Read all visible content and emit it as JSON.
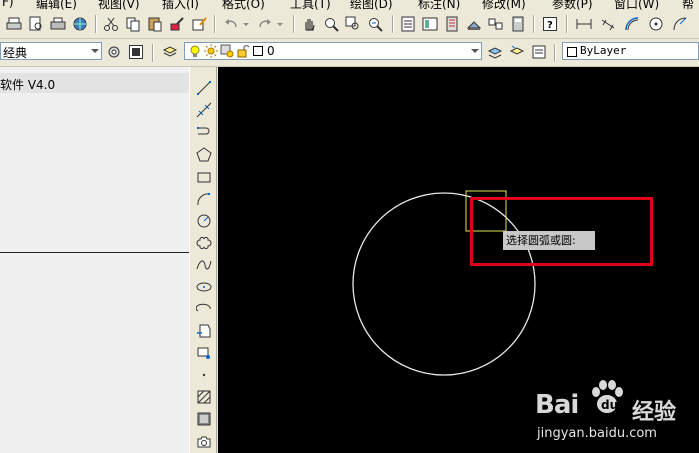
{
  "menubar": {
    "items": [
      "F)",
      "编辑(E)",
      "视图(V)",
      "插入(I)",
      "格式(O)",
      "工具(T)",
      "绘图(D)",
      "标注(N)",
      "修改(M)",
      "参数(P)",
      "窗口(W)",
      "帮"
    ]
  },
  "toolbar2": {
    "workspace": "经典",
    "layer": "0",
    "color": "ByLayer"
  },
  "left_panel": {
    "title": "软件 V4.0"
  },
  "canvas": {
    "tooltip": "选择圆弧或圆:",
    "background": "#000000",
    "circle_color": "#e8e8e8",
    "pickbox_color": "#e6e650",
    "highlight_color": "#e0001a"
  },
  "watermark": {
    "brand": "Bai",
    "brand2": "经验",
    "url": "jingyan.baidu.com"
  }
}
